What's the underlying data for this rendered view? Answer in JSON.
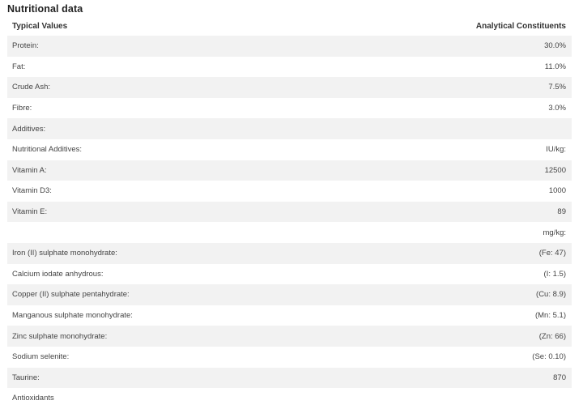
{
  "title": "Nutritional data",
  "table": {
    "header": {
      "left": "Typical Values",
      "right": "Analytical Constituents"
    },
    "rows": [
      {
        "label": "Protein:",
        "value": "30.0%"
      },
      {
        "label": "Fat:",
        "value": "11.0%"
      },
      {
        "label": "Crude Ash:",
        "value": "7.5%"
      },
      {
        "label": "Fibre:",
        "value": "3.0%"
      },
      {
        "label": "Additives:",
        "value": ""
      },
      {
        "label": "Nutritional Additives:",
        "value": "IU/kg:"
      },
      {
        "label": "Vitamin A:",
        "value": "12500"
      },
      {
        "label": "Vitamin D3:",
        "value": "1000"
      },
      {
        "label": "Vitamin E:",
        "value": "89"
      },
      {
        "label": "",
        "value": "mg/kg:"
      },
      {
        "label": "Iron (II) sulphate monohydrate:",
        "value": "(Fe: 47)"
      },
      {
        "label": "Calcium iodate anhydrous:",
        "value": "(I: 1.5)"
      },
      {
        "label": "Copper (II) sulphate pentahydrate:",
        "value": "(Cu: 8.9)"
      },
      {
        "label": "Manganous sulphate monohydrate:",
        "value": "(Mn: 5.1)"
      },
      {
        "label": "Zinc sulphate monohydrate:",
        "value": "(Zn: 66)"
      },
      {
        "label": "Sodium selenite:",
        "value": "(Se: 0.10)"
      },
      {
        "label": "Taurine:",
        "value": "870"
      },
      {
        "label": "Antioxidants",
        "value": ""
      }
    ]
  }
}
